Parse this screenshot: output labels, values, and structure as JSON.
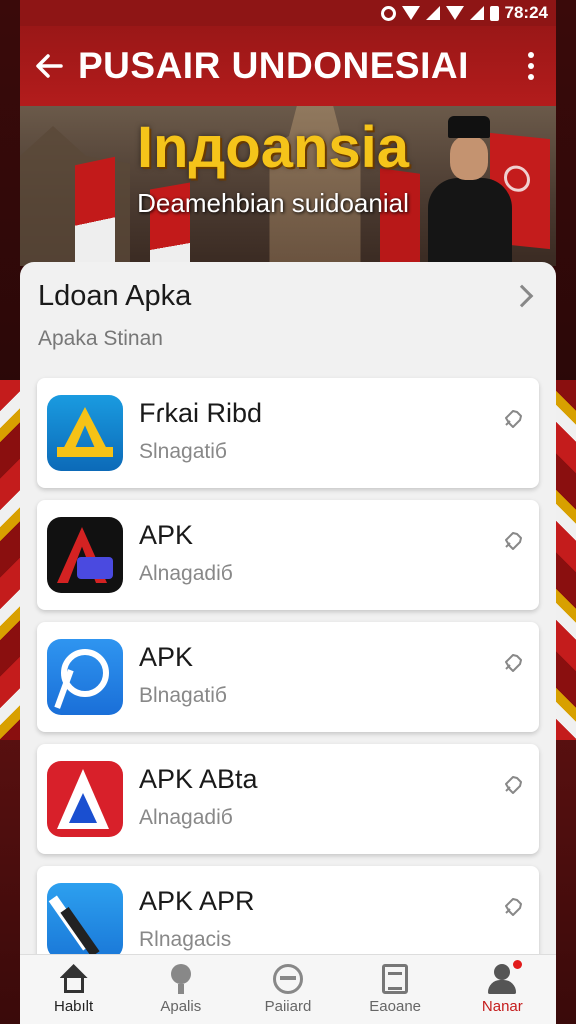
{
  "status_bar": {
    "time": "78:24"
  },
  "app_bar": {
    "title": "PUSAIR UNDONESIAI",
    "back_icon": "back-arrow-icon",
    "more_icon": "more-vertical-icon"
  },
  "hero": {
    "title": "Inдoansia",
    "subtitle": "Deamehbian suidoanial"
  },
  "section": {
    "title": "Ldoan Apka",
    "subtitle": "Apaka Stinan"
  },
  "apps": [
    {
      "name": "Fɾkai Ribd",
      "desc": "Slnagatiб",
      "icon": "app-icon-a-yellow"
    },
    {
      "name": "APK",
      "desc": "Alnagadiб",
      "icon": "app-icon-a-red-star"
    },
    {
      "name": "APK",
      "desc": "Blnagatiб",
      "icon": "app-icon-p-blue"
    },
    {
      "name": "APK ABta",
      "desc": "Alnagadiб",
      "icon": "app-icon-a-red-triangle"
    },
    {
      "name": "APK APR",
      "desc": "Rlnagacis",
      "icon": "app-icon-pen-blue"
    }
  ],
  "bottom_nav": [
    {
      "label": "Habılt",
      "icon": "home-icon"
    },
    {
      "label": "Apalis",
      "icon": "apps-icon"
    },
    {
      "label": "Paiiard",
      "icon": "globe-icon"
    },
    {
      "label": "Eaoane",
      "icon": "document-icon"
    },
    {
      "label": "Nanar",
      "icon": "user-icon"
    }
  ],
  "colors": {
    "app_bar": "#b31c1c",
    "accent": "#c51d1d",
    "hero_title": "#f5c41a"
  }
}
